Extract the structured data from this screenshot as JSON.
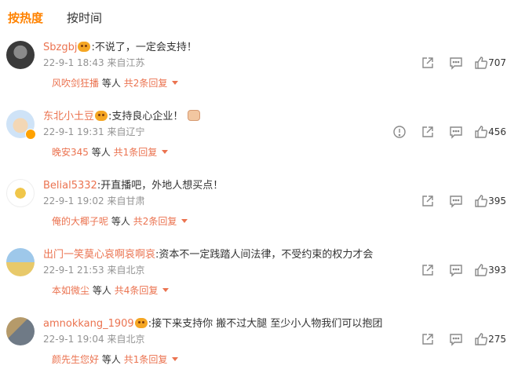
{
  "tabs": {
    "hot": "按热度",
    "time": "按时间"
  },
  "comments": [
    {
      "user": "Sbzgbj",
      "text": ":不说了，一定会支持！",
      "time": "22-9-1 18:43",
      "location": "来自江苏",
      "reply_user": "风吹剑狂播",
      "reply_mid": "等人",
      "reply_count": "共2条回复",
      "likes": "707"
    },
    {
      "user": "东北小土豆",
      "text": ":支持良心企业！",
      "time": "22-9-1 19:31",
      "location": "来自辽宁",
      "reply_user": "晚安345",
      "reply_mid": "等人",
      "reply_count": "共1条回复",
      "likes": "456"
    },
    {
      "user": "Belial5332",
      "text": ":开直播吧，外地人想买点！",
      "time": "22-9-1 19:02",
      "location": "来自甘肃",
      "reply_user": "俺的大椰子呢",
      "reply_mid": "等人",
      "reply_count": "共2条回复",
      "likes": "395"
    },
    {
      "user": "出门一笑莫心哀啊哀啊哀",
      "text": ":资本不一定践踏人间法律，不受约束的权力才会",
      "time": "22-9-1 21:53",
      "location": "来自北京",
      "reply_user": "本如微尘",
      "reply_mid": "等人",
      "reply_count": "共4条回复",
      "likes": "393"
    },
    {
      "user": "amnokkang_1909",
      "text": ":接下来支持你 搬不过大腿 至少小人物我们可以抱团",
      "time": "22-9-1 19:04",
      "location": "来自北京",
      "reply_user": "颜先生您好",
      "reply_mid": "等人",
      "reply_count": "共1条回复",
      "likes": "275"
    }
  ]
}
